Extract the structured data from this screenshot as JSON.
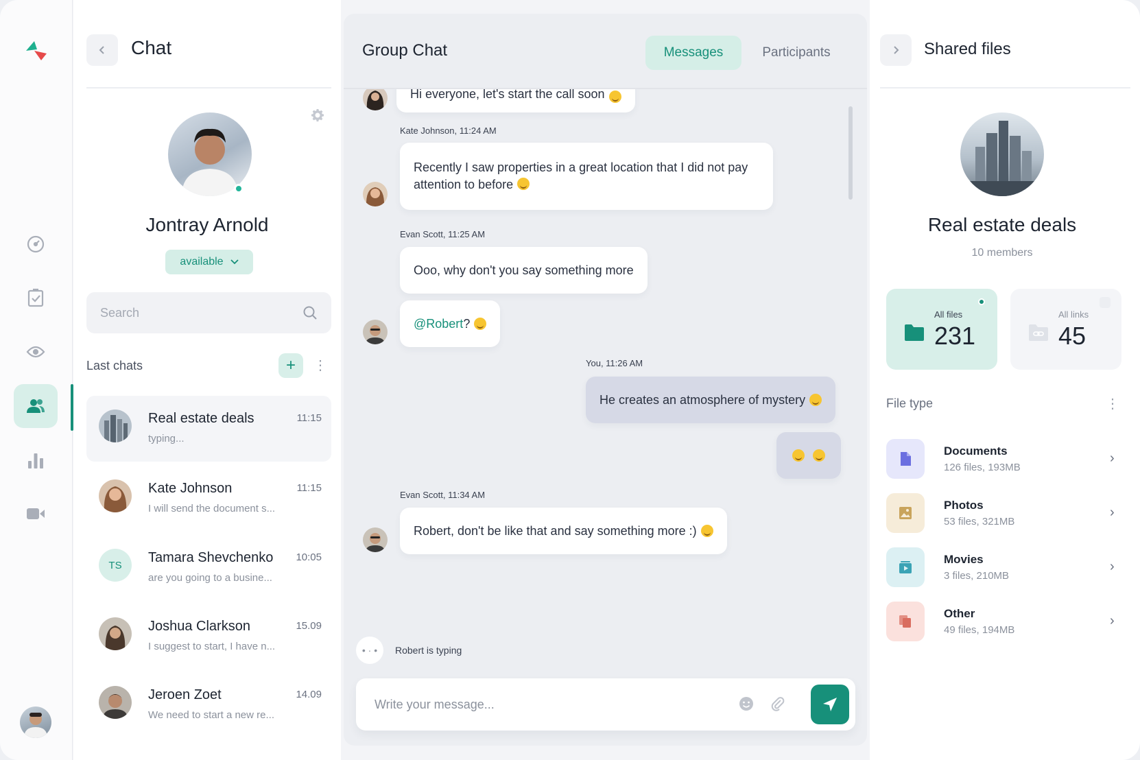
{
  "left_panel": {
    "title": "Chat",
    "profile": {
      "name": "Jontray Arnold",
      "status": "available"
    },
    "search": {
      "placeholder": "Search"
    },
    "last_chats_label": "Last chats",
    "chats": [
      {
        "name": "Real estate deals",
        "time": "11:15",
        "preview": "typing..."
      },
      {
        "name": "Kate Johnson",
        "time": "11:15",
        "preview": "I will send the document s..."
      },
      {
        "name": "Tamara Shevchenko",
        "time": "10:05",
        "preview": "are you going to a busine...",
        "initials": "TS"
      },
      {
        "name": "Joshua Clarkson",
        "time": "15.09",
        "preview": "I suggest to start, I have n..."
      },
      {
        "name": "Jeroen Zoet",
        "time": "14.09",
        "preview": "We need to start a new re..."
      }
    ]
  },
  "chat": {
    "title": "Group Chat",
    "tabs": {
      "messages": "Messages",
      "participants": "Participants"
    },
    "messages": [
      {
        "text": "Hi everyone, let's start the call soon"
      },
      {
        "sender": "Kate Johnson, 11:24 AM",
        "text": "Recently I saw properties in a great location that I did not pay attention to before"
      },
      {
        "sender": "Evan Scott, 11:25 AM",
        "text": "Ooo, why don't you say something more"
      },
      {
        "mention": "@Robert",
        "text": " ?"
      },
      {
        "sender": "You, 11:26 AM",
        "text": "He creates an atmosphere of mystery"
      },
      {
        "sender": "Evan Scott, 11:34 AM",
        "text": "Robert, don't be like that and say something more :)"
      }
    ],
    "typing_indicator": "Robert is typing",
    "composer": {
      "placeholder": "Write your message..."
    }
  },
  "right_panel": {
    "title": "Shared files",
    "group": {
      "name": "Real estate deals",
      "members": "10 members"
    },
    "stats": {
      "files": {
        "label": "All files",
        "value": "231"
      },
      "links": {
        "label": "All links",
        "value": "45"
      }
    },
    "file_type_label": "File type",
    "file_types": [
      {
        "name": "Documents",
        "meta": "126 files, 193MB",
        "color": "#6b6fe0",
        "bg": "#e6e7fb"
      },
      {
        "name": "Photos",
        "meta": "53 files, 321MB",
        "color": "#c9a45c",
        "bg": "#f6ecd9"
      },
      {
        "name": "Movies",
        "meta": "3 files, 210MB",
        "color": "#3aa3b5",
        "bg": "#dcf0f3"
      },
      {
        "name": "Other",
        "meta": "49 files, 194MB",
        "color": "#d96d5f",
        "bg": "#fbe1dd"
      }
    ]
  },
  "colors": {
    "accent": "#17907a",
    "accent_soft": "#d8efe9"
  }
}
